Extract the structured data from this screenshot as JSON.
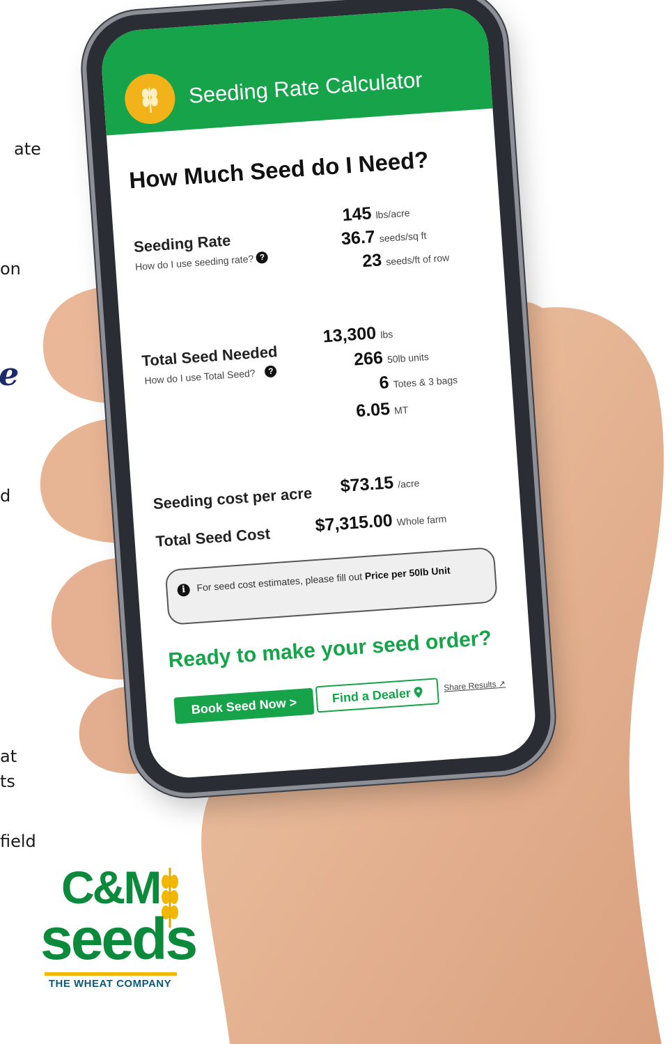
{
  "page_fragments": [
    "ate",
    "on",
    "e",
    "d",
    "at",
    "ts",
    "field"
  ],
  "brand": {
    "logo_text_top": "C&M",
    "logo_text_main": "seeds",
    "tagline": "THE WHEAT COMPANY",
    "green": "#0a8a3a",
    "gold": "#f2b705"
  },
  "app": {
    "title": "Seeding Rate Calculator",
    "header_color": "#16a34a",
    "logo_icon": "wheat-icon"
  },
  "screen": {
    "heading": "How Much Seed do I Need?",
    "seeding_rate": {
      "label": "Seeding Rate",
      "help": "How do I use seeding rate?",
      "values": [
        {
          "num": "145",
          "unit": "lbs/acre"
        },
        {
          "num": "36.7",
          "unit": "seeds/sq ft"
        },
        {
          "num": "23",
          "unit": "seeds/ft of row"
        }
      ]
    },
    "total_seed": {
      "label": "Total Seed Needed",
      "help": "How do I use Total Seed?",
      "values": [
        {
          "num": "13,300",
          "unit": "lbs"
        },
        {
          "num": "266",
          "unit": "50lb units"
        },
        {
          "num": "6",
          "unit": "Totes & 3 bags"
        },
        {
          "num": "6.05",
          "unit": "MT"
        }
      ]
    },
    "cost_per_acre": {
      "label": "Seeding cost per acre",
      "num": "$73.15",
      "unit": "/acre"
    },
    "total_cost": {
      "label": "Total Seed Cost",
      "num": "$7,315.00",
      "unit": "Whole farm"
    },
    "notice": {
      "prefix": "For seed cost estimates, please fill out ",
      "bold": "Price per 50lb Unit"
    },
    "cta": "Ready to make your seed order?",
    "book_button": "Book Seed Now >",
    "dealer_button": "Find a Dealer",
    "share_link": "Share Results"
  }
}
